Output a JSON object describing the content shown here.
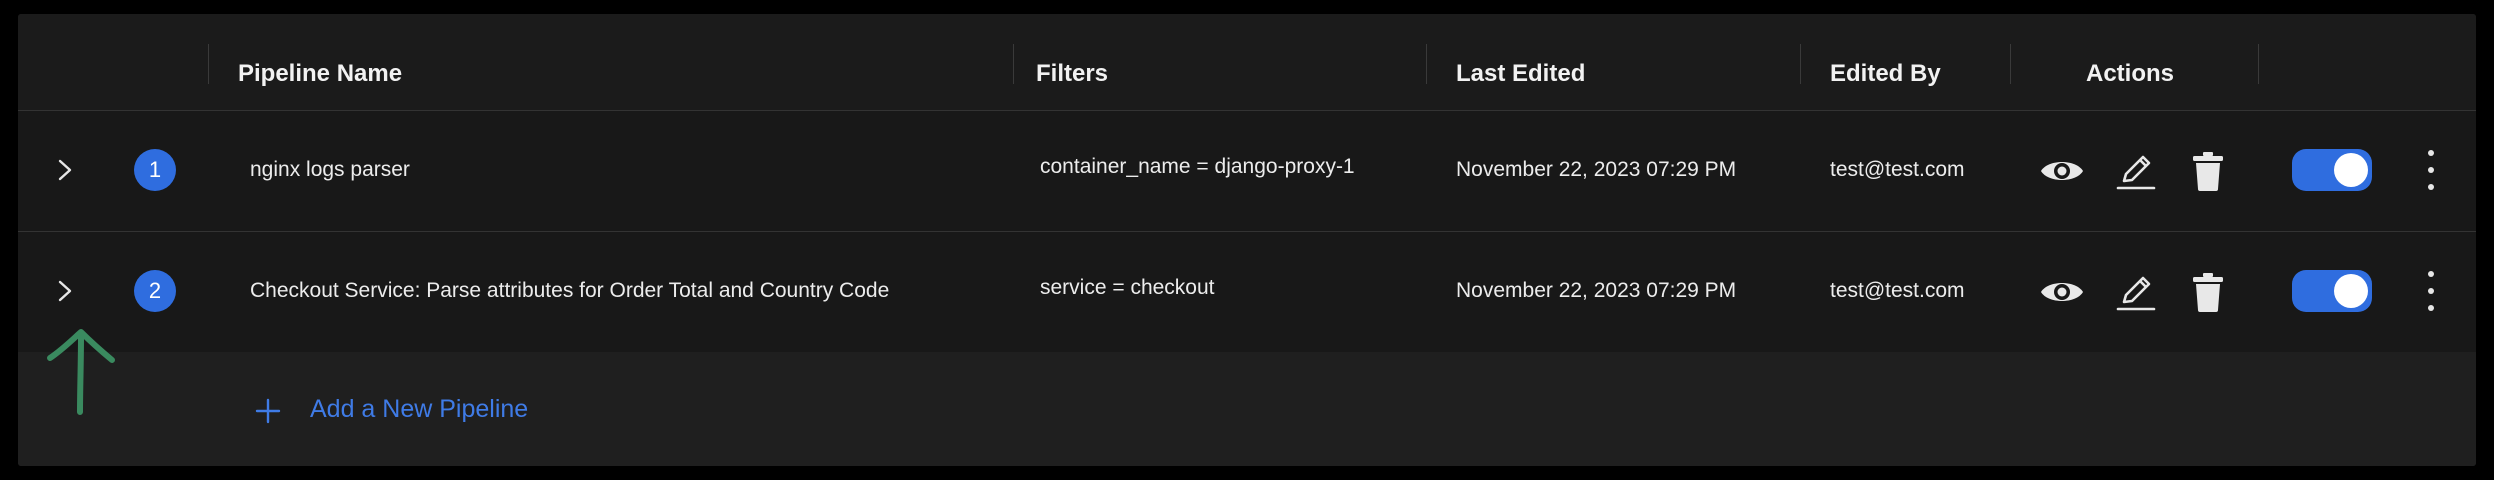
{
  "table": {
    "headers": {
      "pipeline_name": "Pipeline Name",
      "filters": "Filters",
      "last_edited": "Last Edited",
      "edited_by": "Edited By",
      "actions": "Actions"
    },
    "rows": [
      {
        "index": "1",
        "name": "nginx logs parser",
        "filter": "container_name = django-proxy-1",
        "last_edited": "November 22, 2023 07:29 PM",
        "edited_by": "test@test.com",
        "enabled": true
      },
      {
        "index": "2",
        "name": "Checkout Service: Parse attributes for Order Total and Country Code",
        "filter": "service = checkout",
        "last_edited": "November 22, 2023 07:29 PM",
        "edited_by": "test@test.com",
        "enabled": true
      }
    ],
    "add_label": "Add a New Pipeline"
  },
  "icons": {
    "expand": "chevron-right-icon",
    "view": "eye-icon",
    "edit": "pencil-icon",
    "delete": "trash-icon",
    "drag": "kebab-icon",
    "add": "plus-icon",
    "annotation": "arrow-up-icon"
  },
  "colors": {
    "accent": "#2f6ddf",
    "link": "#3f7be6",
    "annotation": "#3a8a5f",
    "background": "#1f1f1f"
  }
}
